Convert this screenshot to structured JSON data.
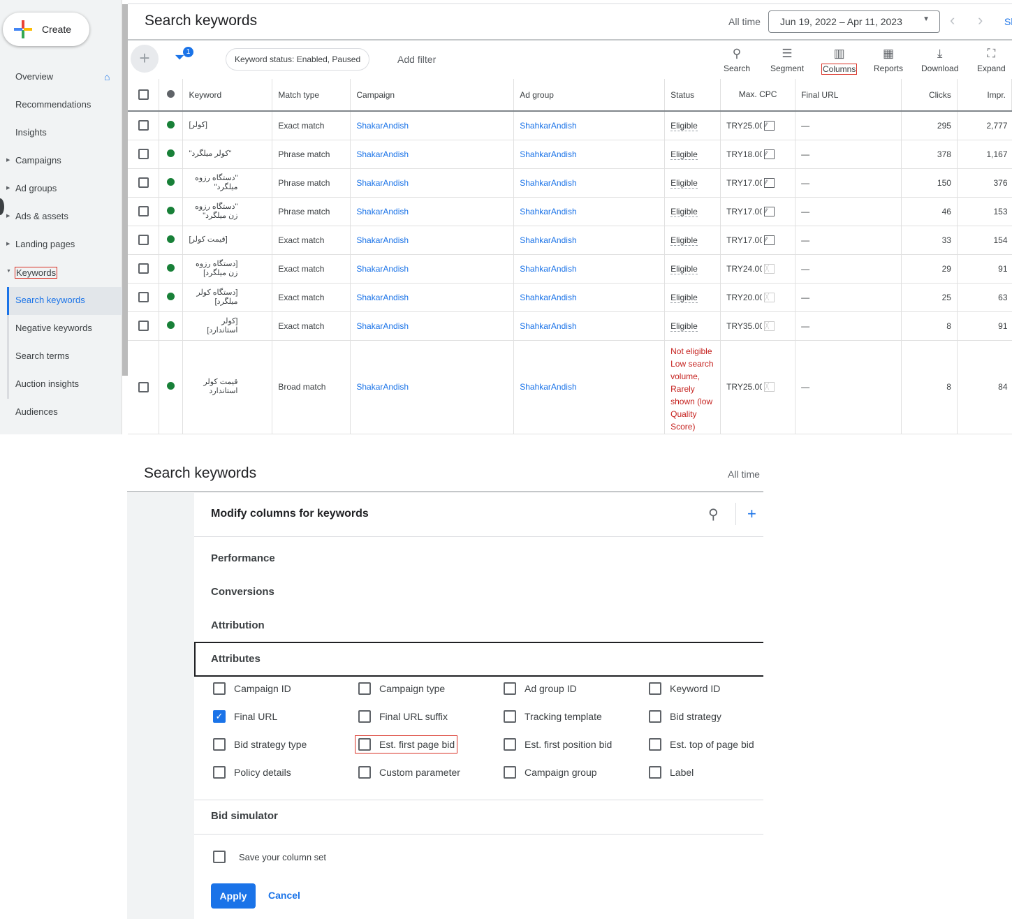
{
  "sidebar": {
    "create": "Create",
    "items": [
      {
        "label": "Overview"
      },
      {
        "label": "Recommendations"
      },
      {
        "label": "Insights"
      },
      {
        "label": "Campaigns",
        "arrow": true
      },
      {
        "label": "Ad groups",
        "arrow": true
      },
      {
        "label": "Ads & assets",
        "arrow": true
      },
      {
        "label": "Landing pages",
        "arrow": true
      },
      {
        "label": "Keywords",
        "arrow": true,
        "open": true
      },
      {
        "label": "Search keywords",
        "selected": true
      },
      {
        "label": "Negative keywords"
      },
      {
        "label": "Search terms"
      },
      {
        "label": "Auction insights"
      },
      {
        "label": "Audiences"
      }
    ]
  },
  "header": {
    "title": "Search keywords",
    "range_label": "All time",
    "date_range": "Jun 19, 2022 – Apr 11, 2023",
    "cut_link": "Sh"
  },
  "filterbar": {
    "filter_count": "1",
    "chip": "Keyword status: Enabled, Paused",
    "add_filter": "Add filter"
  },
  "toolbar": [
    {
      "label": "Search",
      "icon": "search-icon"
    },
    {
      "label": "Segment",
      "icon": "segment-icon"
    },
    {
      "label": "Columns",
      "icon": "columns-icon"
    },
    {
      "label": "Reports",
      "icon": "reports-icon"
    },
    {
      "label": "Download",
      "icon": "download-icon"
    },
    {
      "label": "Expand",
      "icon": "expand-icon"
    }
  ],
  "table": {
    "headers": [
      "Keyword",
      "Match type",
      "Campaign",
      "Ad group",
      "Status",
      "Max. CPC",
      "Final URL",
      "Clicks",
      "Impr."
    ],
    "rows": [
      {
        "keyword": "[کولر]",
        "match": "Exact match",
        "campaign": "ShakarAndish",
        "adgroup": "ShahkarAndish",
        "status": "Eligible",
        "cpc": "TRY25.00",
        "final_url": "—",
        "clicks": "295",
        "impr": "2,777",
        "chart": true
      },
      {
        "keyword": "\"کولر میلگرد\"",
        "match": "Phrase match",
        "campaign": "ShakarAndish",
        "adgroup": "ShahkarAndish",
        "status": "Eligible",
        "cpc": "TRY18.00",
        "final_url": "—",
        "clicks": "378",
        "impr": "1,167",
        "chart": true
      },
      {
        "keyword": "\"دستگاه رزوه میلگرد\"",
        "match": "Phrase match",
        "campaign": "ShakarAndish",
        "adgroup": "ShahkarAndish",
        "status": "Eligible",
        "cpc": "TRY17.00",
        "final_url": "—",
        "clicks": "150",
        "impr": "376",
        "chart": true
      },
      {
        "keyword": "\"دستگاه رزوه زن میلگرد\"",
        "match": "Phrase match",
        "campaign": "ShakarAndish",
        "adgroup": "ShahkarAndish",
        "status": "Eligible",
        "cpc": "TRY17.00",
        "final_url": "—",
        "clicks": "46",
        "impr": "153",
        "chart": true
      },
      {
        "keyword": "[قیمت کولر]",
        "match": "Exact match",
        "campaign": "ShakarAndish",
        "adgroup": "ShahkarAndish",
        "status": "Eligible",
        "cpc": "TRY17.00",
        "final_url": "—",
        "clicks": "33",
        "impr": "154",
        "chart": true
      },
      {
        "keyword": "[دستگاه رزوه زن میلگرد]",
        "match": "Exact match",
        "campaign": "ShakarAndish",
        "adgroup": "ShahkarAndish",
        "status": "Eligible",
        "cpc": "TRY24.00",
        "final_url": "—",
        "clicks": "29",
        "impr": "91",
        "chart": false
      },
      {
        "keyword": "[دستگاه کولر میلگرد]",
        "match": "Exact match",
        "campaign": "ShakarAndish",
        "adgroup": "ShahkarAndish",
        "status": "Eligible",
        "cpc": "TRY20.00",
        "final_url": "—",
        "clicks": "25",
        "impr": "63",
        "chart": false
      },
      {
        "keyword": "[کولر استاندارد]",
        "match": "Exact match",
        "campaign": "ShakarAndish",
        "adgroup": "ShahkarAndish",
        "status": "Eligible",
        "cpc": "TRY35.00",
        "final_url": "—",
        "clicks": "8",
        "impr": "91",
        "chart": false
      },
      {
        "keyword": "قیمت کولر استاندارد",
        "match": "Broad match",
        "campaign": "ShakarAndish",
        "adgroup": "ShahkarAndish",
        "status": "Not eligible Low search volume, Rarely shown (low Quality Score)",
        "cpc": "TRY25.00",
        "final_url": "—",
        "clicks": "8",
        "impr": "84",
        "chart": false,
        "not_eligible": true
      }
    ]
  },
  "panel": {
    "title": "Search keywords",
    "range_label": "All time",
    "heading": "Modify columns for keywords",
    "sections": [
      "Performance",
      "Conversions",
      "Attribution",
      "Attributes"
    ],
    "attributes": [
      {
        "label": "Campaign ID",
        "checked": false
      },
      {
        "label": "Campaign type",
        "checked": false
      },
      {
        "label": "Ad group ID",
        "checked": false
      },
      {
        "label": "Keyword ID",
        "checked": false
      },
      {
        "label": "Final URL",
        "checked": true
      },
      {
        "label": "Final URL suffix",
        "checked": false
      },
      {
        "label": "Tracking template",
        "checked": false
      },
      {
        "label": "Bid strategy",
        "checked": false
      },
      {
        "label": "Bid strategy type",
        "checked": false
      },
      {
        "label": "Est. first page bid",
        "checked": false,
        "highlight": true
      },
      {
        "label": "Est. first position bid",
        "checked": false
      },
      {
        "label": "Est. top of page bid",
        "checked": false
      },
      {
        "label": "Policy details",
        "checked": false
      },
      {
        "label": "Custom parameter",
        "checked": false
      },
      {
        "label": "Campaign group",
        "checked": false
      },
      {
        "label": "Label",
        "checked": false
      }
    ],
    "bid_simulator": "Bid simulator",
    "save_set": "Save your column set",
    "apply": "Apply",
    "cancel": "Cancel"
  },
  "colors": {
    "accent": "#1a73e8",
    "enabled": "#188038",
    "error": "#c5221f",
    "highlight": "#d93025"
  }
}
